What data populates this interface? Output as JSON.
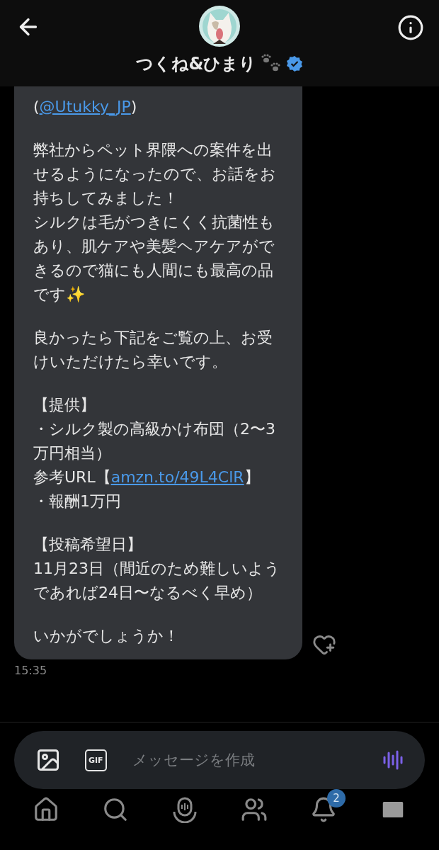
{
  "header": {
    "name": "つくね&ひまり",
    "verified": true
  },
  "message": {
    "blocks": [
      [
        [
          {
            "text": "("
          },
          {
            "text": "@Utukky_JP",
            "link": true
          },
          {
            "text": ")"
          }
        ]
      ],
      [
        [
          {
            "text": "弊社からペット界隈への案件を出せるようになったので、お話をお持ちしてみました！"
          }
        ],
        [
          {
            "text": "シルクは毛がつきにくく抗菌性もあり、肌ケアや美髪ヘアケアができるので猫にも人間にも最高の品です✨"
          }
        ]
      ],
      [
        [
          {
            "text": "良かったら下記をご覧の上、お受けいただけたら幸いです。"
          }
        ]
      ],
      [
        [
          {
            "text": "【提供】"
          }
        ],
        [
          {
            "text": "・シルク製の高級かけ布団（2〜3万円相当）"
          }
        ],
        [
          {
            "text": "参考URL【"
          },
          {
            "text": "amzn.to/49L4ClR",
            "link": true
          },
          {
            "text": "】"
          }
        ],
        [
          {
            "text": "・報酬1万円"
          }
        ]
      ],
      [
        [
          {
            "text": "【投稿希望日】"
          }
        ],
        [
          {
            "text": "11月23日（間近のため難しいようであれば24日〜なるべく早め）"
          }
        ]
      ],
      [
        [
          {
            "text": "いかがでしょうか！"
          }
        ]
      ]
    ],
    "time": "15:35"
  },
  "composer": {
    "gif_label": "GIF",
    "placeholder": "メッセージを作成"
  },
  "nav": [
    {
      "kind": "home",
      "selected": false
    },
    {
      "kind": "search",
      "selected": false
    },
    {
      "kind": "spaces",
      "selected": false
    },
    {
      "kind": "communities",
      "selected": false
    },
    {
      "kind": "notifications",
      "selected": false,
      "badge": "2"
    },
    {
      "kind": "messages",
      "selected": true
    }
  ]
}
